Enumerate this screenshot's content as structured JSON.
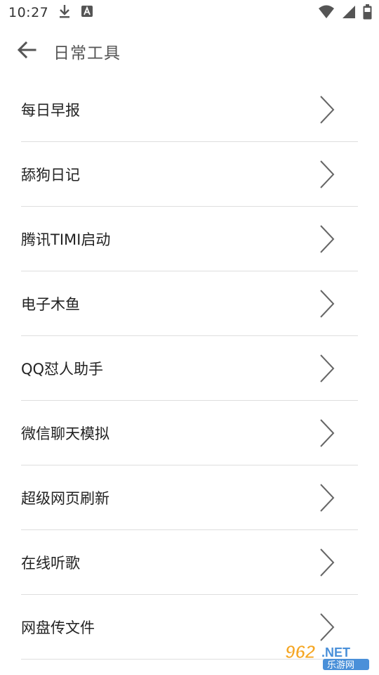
{
  "status": {
    "time": "10:27",
    "icons": [
      "download-icon",
      "accessibility-a-icon",
      "wifi-icon",
      "signal-icon",
      "battery-icon"
    ]
  },
  "header": {
    "title": "日常工具",
    "back_icon": "arrow-left-icon"
  },
  "menu": {
    "items": [
      {
        "label": "每日早报"
      },
      {
        "label": "舔狗日记"
      },
      {
        "label": "腾讯TIMI启动"
      },
      {
        "label": "电子木鱼"
      },
      {
        "label": "QQ怼人助手"
      },
      {
        "label": "微信聊天模拟"
      },
      {
        "label": "超级网页刷新"
      },
      {
        "label": "在线听歌"
      },
      {
        "label": "网盘传文件"
      }
    ]
  },
  "watermark": {
    "number": "962",
    "suffix": ".NET",
    "text": "乐游网",
    "colors": {
      "orange": "#f5a623",
      "blue": "#4a90d9"
    }
  }
}
